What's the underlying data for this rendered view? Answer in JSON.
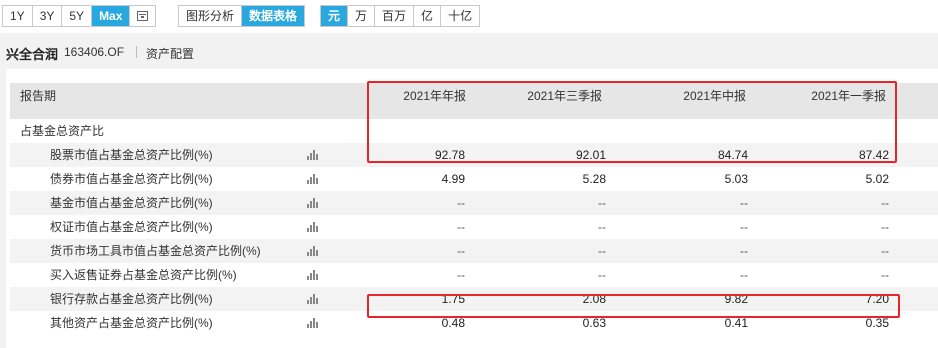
{
  "toolbar": {
    "range_buttons": [
      "1Y",
      "3Y",
      "5Y",
      "Max"
    ],
    "active_range": "Max",
    "view_buttons": [
      "图形分析",
      "数据表格"
    ],
    "active_view": "数据表格",
    "unit_buttons": [
      "元",
      "万",
      "百万",
      "亿",
      "十亿"
    ],
    "active_unit": "元"
  },
  "fund": {
    "name": "兴全合润",
    "code": "163406.OF",
    "section": "资产配置"
  },
  "table": {
    "header_label": "报告期",
    "columns": [
      "2021年年报",
      "2021年三季报",
      "2021年中报",
      "2021年一季报"
    ],
    "group_label": "占基金总资产比",
    "rows": [
      {
        "label": "股票市值占基金总资产比例(%)",
        "values": [
          "92.78",
          "92.01",
          "84.74",
          "87.42"
        ]
      },
      {
        "label": "债券市值占基金总资产比例(%)",
        "values": [
          "4.99",
          "5.28",
          "5.03",
          "5.02"
        ]
      },
      {
        "label": "基金市值占基金总资产比例(%)",
        "values": [
          "--",
          "--",
          "--",
          "--"
        ]
      },
      {
        "label": "权证市值占基金总资产比例(%)",
        "values": [
          "--",
          "--",
          "--",
          "--"
        ]
      },
      {
        "label": "货币市场工具市值占基金总资产比例(%)",
        "values": [
          "--",
          "--",
          "--",
          "--"
        ]
      },
      {
        "label": "买入返售证券占基金总资产比例(%)",
        "values": [
          "--",
          "--",
          "--",
          "--"
        ]
      },
      {
        "label": "银行存款占基金总资产比例(%)",
        "values": [
          "1.75",
          "2.08",
          "9.82",
          "7.20"
        ]
      },
      {
        "label": "其他资产占基金总资产比例(%)",
        "values": [
          "0.48",
          "0.63",
          "0.41",
          "0.35"
        ]
      }
    ]
  },
  "colors": {
    "accent": "#29a8df",
    "highlight_box": "#e8262a"
  }
}
